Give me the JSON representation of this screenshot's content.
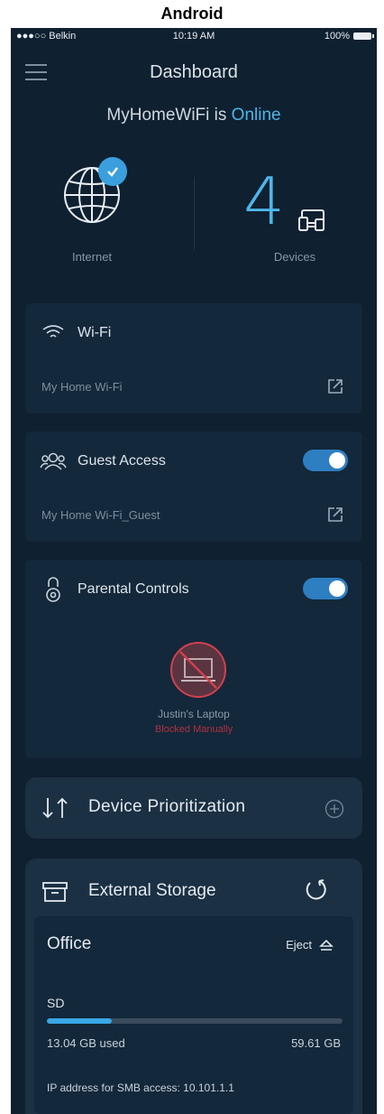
{
  "platform_label": "Android",
  "status_bar": {
    "carrier": "●●●○○ Belkin",
    "time": "10:19 AM",
    "battery": "100%"
  },
  "header": {
    "title": "Dashboard"
  },
  "network": {
    "name": "MyHomeWiFi is",
    "state": "Online"
  },
  "summary": {
    "internet_label": "Internet",
    "device_count": "4",
    "devices_label": "Devices"
  },
  "wifi": {
    "title": "Wi-Fi",
    "network_name": "My Home Wi-Fi"
  },
  "guest_access": {
    "title": "Guest Access",
    "network_name": "My Home Wi-Fi_Guest",
    "enabled": true
  },
  "parental_controls": {
    "title": "Parental Controls",
    "enabled": true,
    "device_name": "Justin's Laptop",
    "device_status": "Blocked Manually"
  },
  "device_prioritization": {
    "title": "Device Prioritization"
  },
  "external_storage": {
    "title": "External Storage",
    "drive": {
      "name": "Office",
      "eject_label": "Eject",
      "partition": "SD",
      "used_label": "13.04 GB used",
      "total_label": "59.61 GB",
      "used_fraction": 0.22,
      "ip_label": "IP address for SMB access: 10.101.1.1"
    }
  },
  "colors": {
    "accent": "#4fb6e9",
    "background": "#0f2030",
    "blocked": "#b0303f"
  }
}
